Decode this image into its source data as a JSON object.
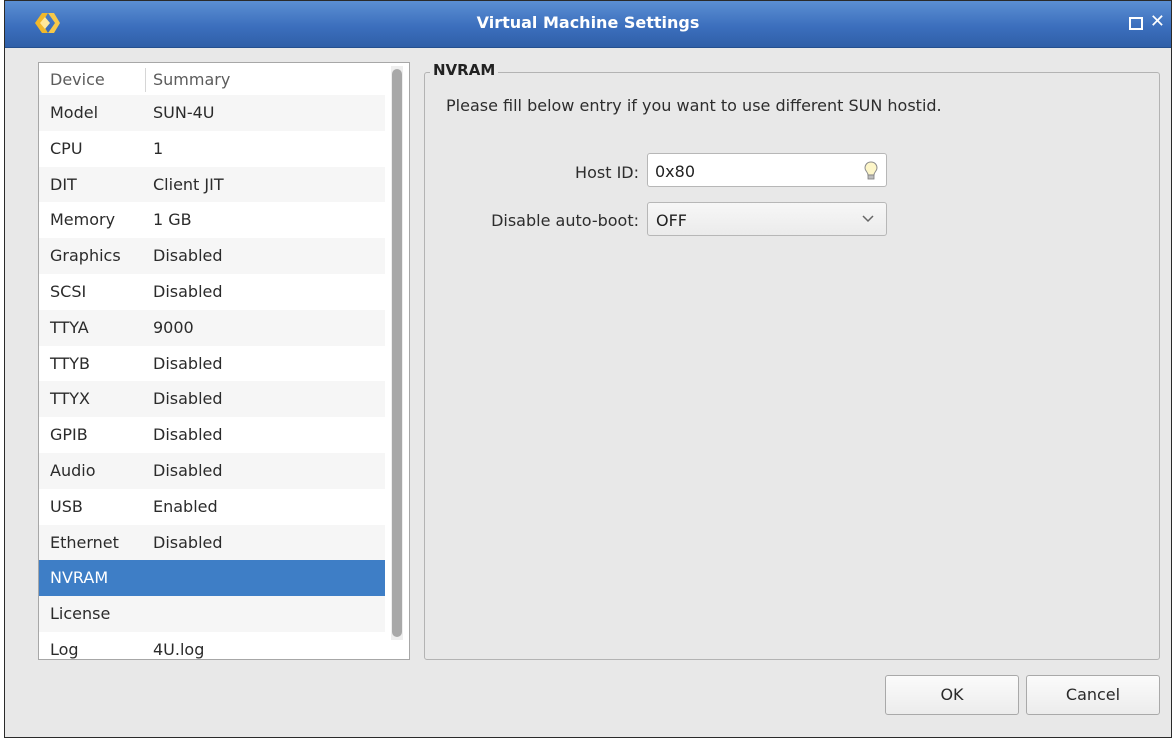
{
  "window": {
    "title": "Virtual Machine Settings",
    "icons": [
      "app-logo-icon",
      "maximize-icon",
      "close-icon"
    ],
    "close_glyph": "✕"
  },
  "device_list": {
    "columns": [
      "Device",
      "Summary"
    ],
    "rows": [
      {
        "device": "Model",
        "summary": "SUN-4U"
      },
      {
        "device": "CPU",
        "summary": "1"
      },
      {
        "device": "DIT",
        "summary": "Client JIT"
      },
      {
        "device": "Memory",
        "summary": "1 GB"
      },
      {
        "device": "Graphics",
        "summary": "Disabled"
      },
      {
        "device": "SCSI",
        "summary": "Disabled"
      },
      {
        "device": "TTYA",
        "summary": "9000"
      },
      {
        "device": "TTYB",
        "summary": "Disabled"
      },
      {
        "device": "TTYX",
        "summary": "Disabled"
      },
      {
        "device": "GPIB",
        "summary": "Disabled"
      },
      {
        "device": "Audio",
        "summary": "Disabled"
      },
      {
        "device": "USB",
        "summary": "Enabled"
      },
      {
        "device": "Ethernet",
        "summary": "Disabled"
      },
      {
        "device": "NVRAM",
        "summary": ""
      },
      {
        "device": "License",
        "summary": ""
      },
      {
        "device": "Log",
        "summary": "4U.log"
      }
    ],
    "selected": "NVRAM"
  },
  "nvram": {
    "group_title": "NVRAM",
    "info": "Please fill below entry if you want to use different SUN hostid.",
    "host_id_label": "Host ID:",
    "host_id_value": "0x80",
    "host_id_icon": "lightbulb-icon",
    "auto_boot_label": "Disable auto-boot:",
    "auto_boot_value": "OFF"
  },
  "buttons": {
    "ok": "OK",
    "cancel": "Cancel"
  },
  "colors": {
    "titlebar": "#3c6fbd",
    "selection": "#3e7ec6",
    "background": "#e8e8e8"
  }
}
